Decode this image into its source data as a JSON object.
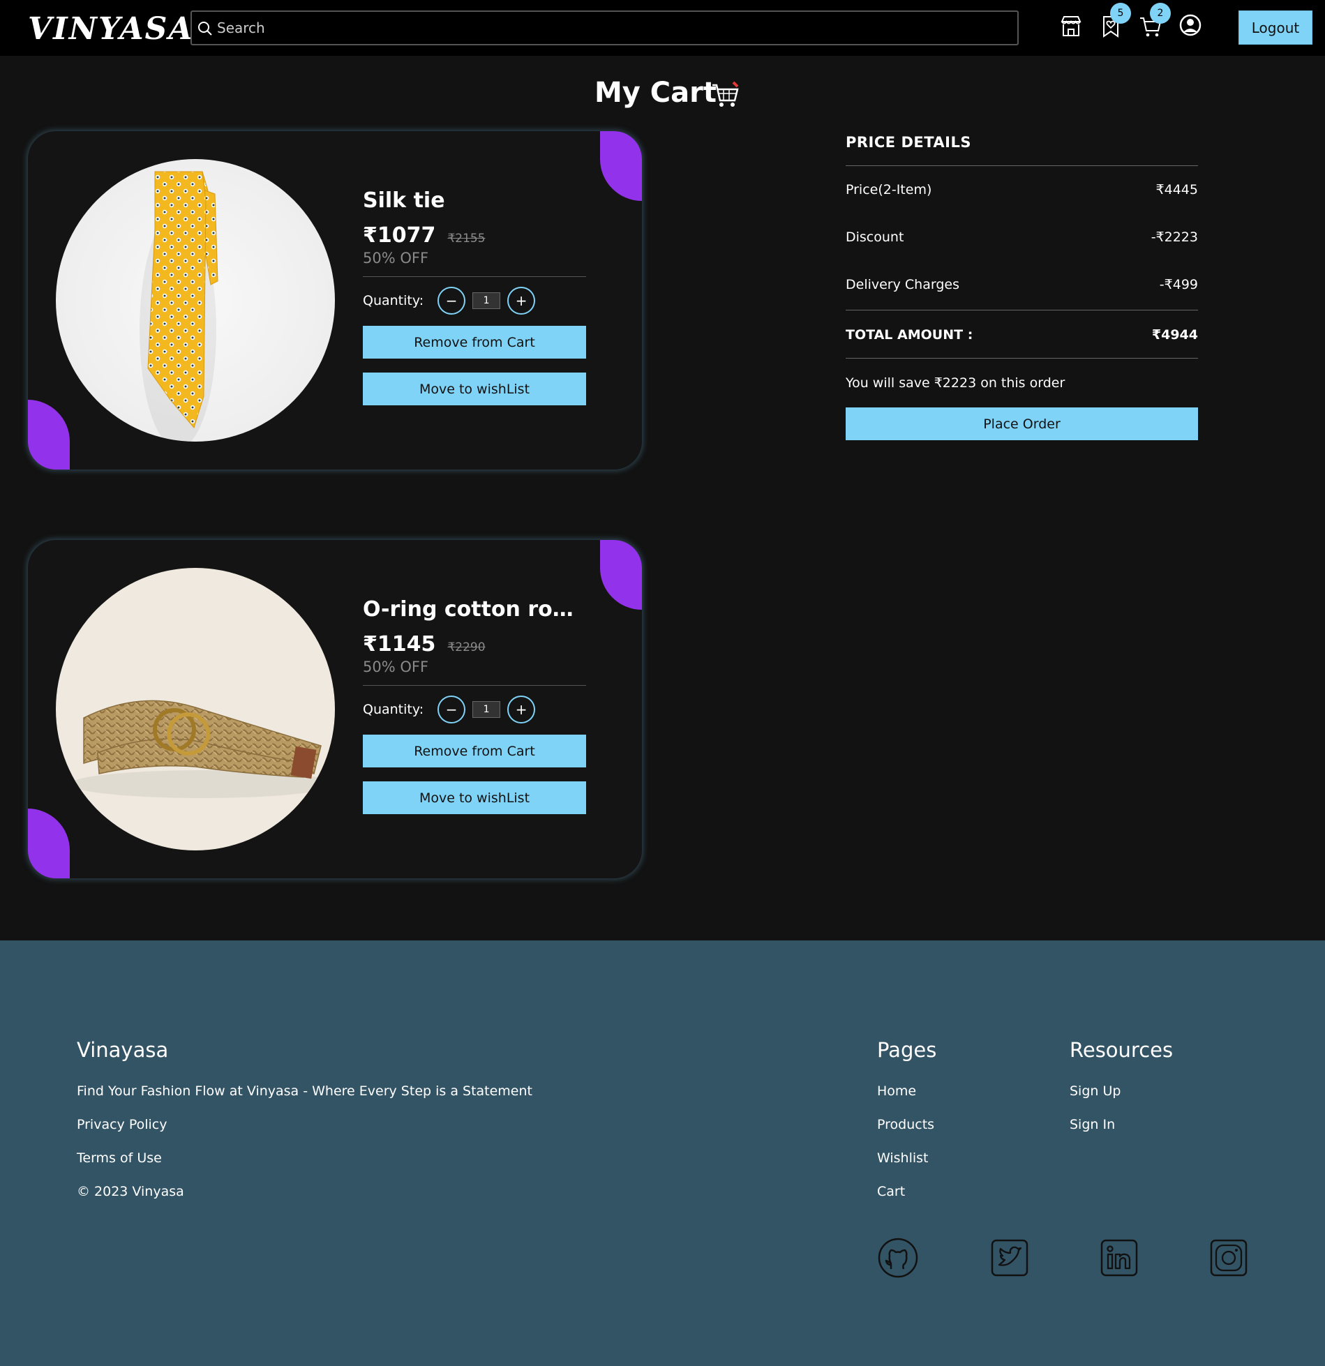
{
  "nav": {
    "logo": "VINYASA",
    "search_placeholder": "Search",
    "wishlist_count": "5",
    "cart_count": "2",
    "logout_label": "Logout"
  },
  "page": {
    "title": "My Cart"
  },
  "cart_items": [
    {
      "name": "Silk tie",
      "price": "₹1077",
      "original_price": "₹2155",
      "discount": "50% OFF",
      "quantity_label": "Quantity:",
      "quantity": "1",
      "remove_label": "Remove from Cart",
      "wishlist_label": "Move to wishList"
    },
    {
      "name": "O-ring cotton rope belt",
      "price": "₹1145",
      "original_price": "₹2290",
      "discount": "50% OFF",
      "quantity_label": "Quantity:",
      "quantity": "1",
      "remove_label": "Remove from Cart",
      "wishlist_label": "Move to wishList"
    }
  ],
  "price_details": {
    "title": "PRICE DETAILS",
    "price_label": "Price(2-Item)",
    "price_value": "₹4445",
    "discount_label": "Discount",
    "discount_value": "-₹2223",
    "delivery_label": "Delivery Charges",
    "delivery_value": "-₹499",
    "total_label": "TOTAL AMOUNT :",
    "total_value": "₹4944",
    "savings_text": "You will save ₹2223 on this order",
    "place_order_label": "Place Order"
  },
  "footer": {
    "brand": "Vinayasa",
    "tagline": "Find Your Fashion Flow at Vinyasa - Where Every Step is a Statement",
    "privacy": "Privacy Policy",
    "terms": "Terms of Use",
    "copyright": "© 2023 Vinyasa",
    "pages_heading": "Pages",
    "pages": [
      "Home",
      "Products",
      "Wishlist",
      "Cart"
    ],
    "resources_heading": "Resources",
    "resources": [
      "Sign Up",
      "Sign In"
    ],
    "social_icons": [
      "github-icon",
      "twitter-icon",
      "linkedin-icon",
      "instagram-icon"
    ]
  },
  "colors": {
    "accent": "#7fd3f7",
    "purple": "#9232ea",
    "footer_bg": "#335465",
    "page_bg": "#121212"
  }
}
